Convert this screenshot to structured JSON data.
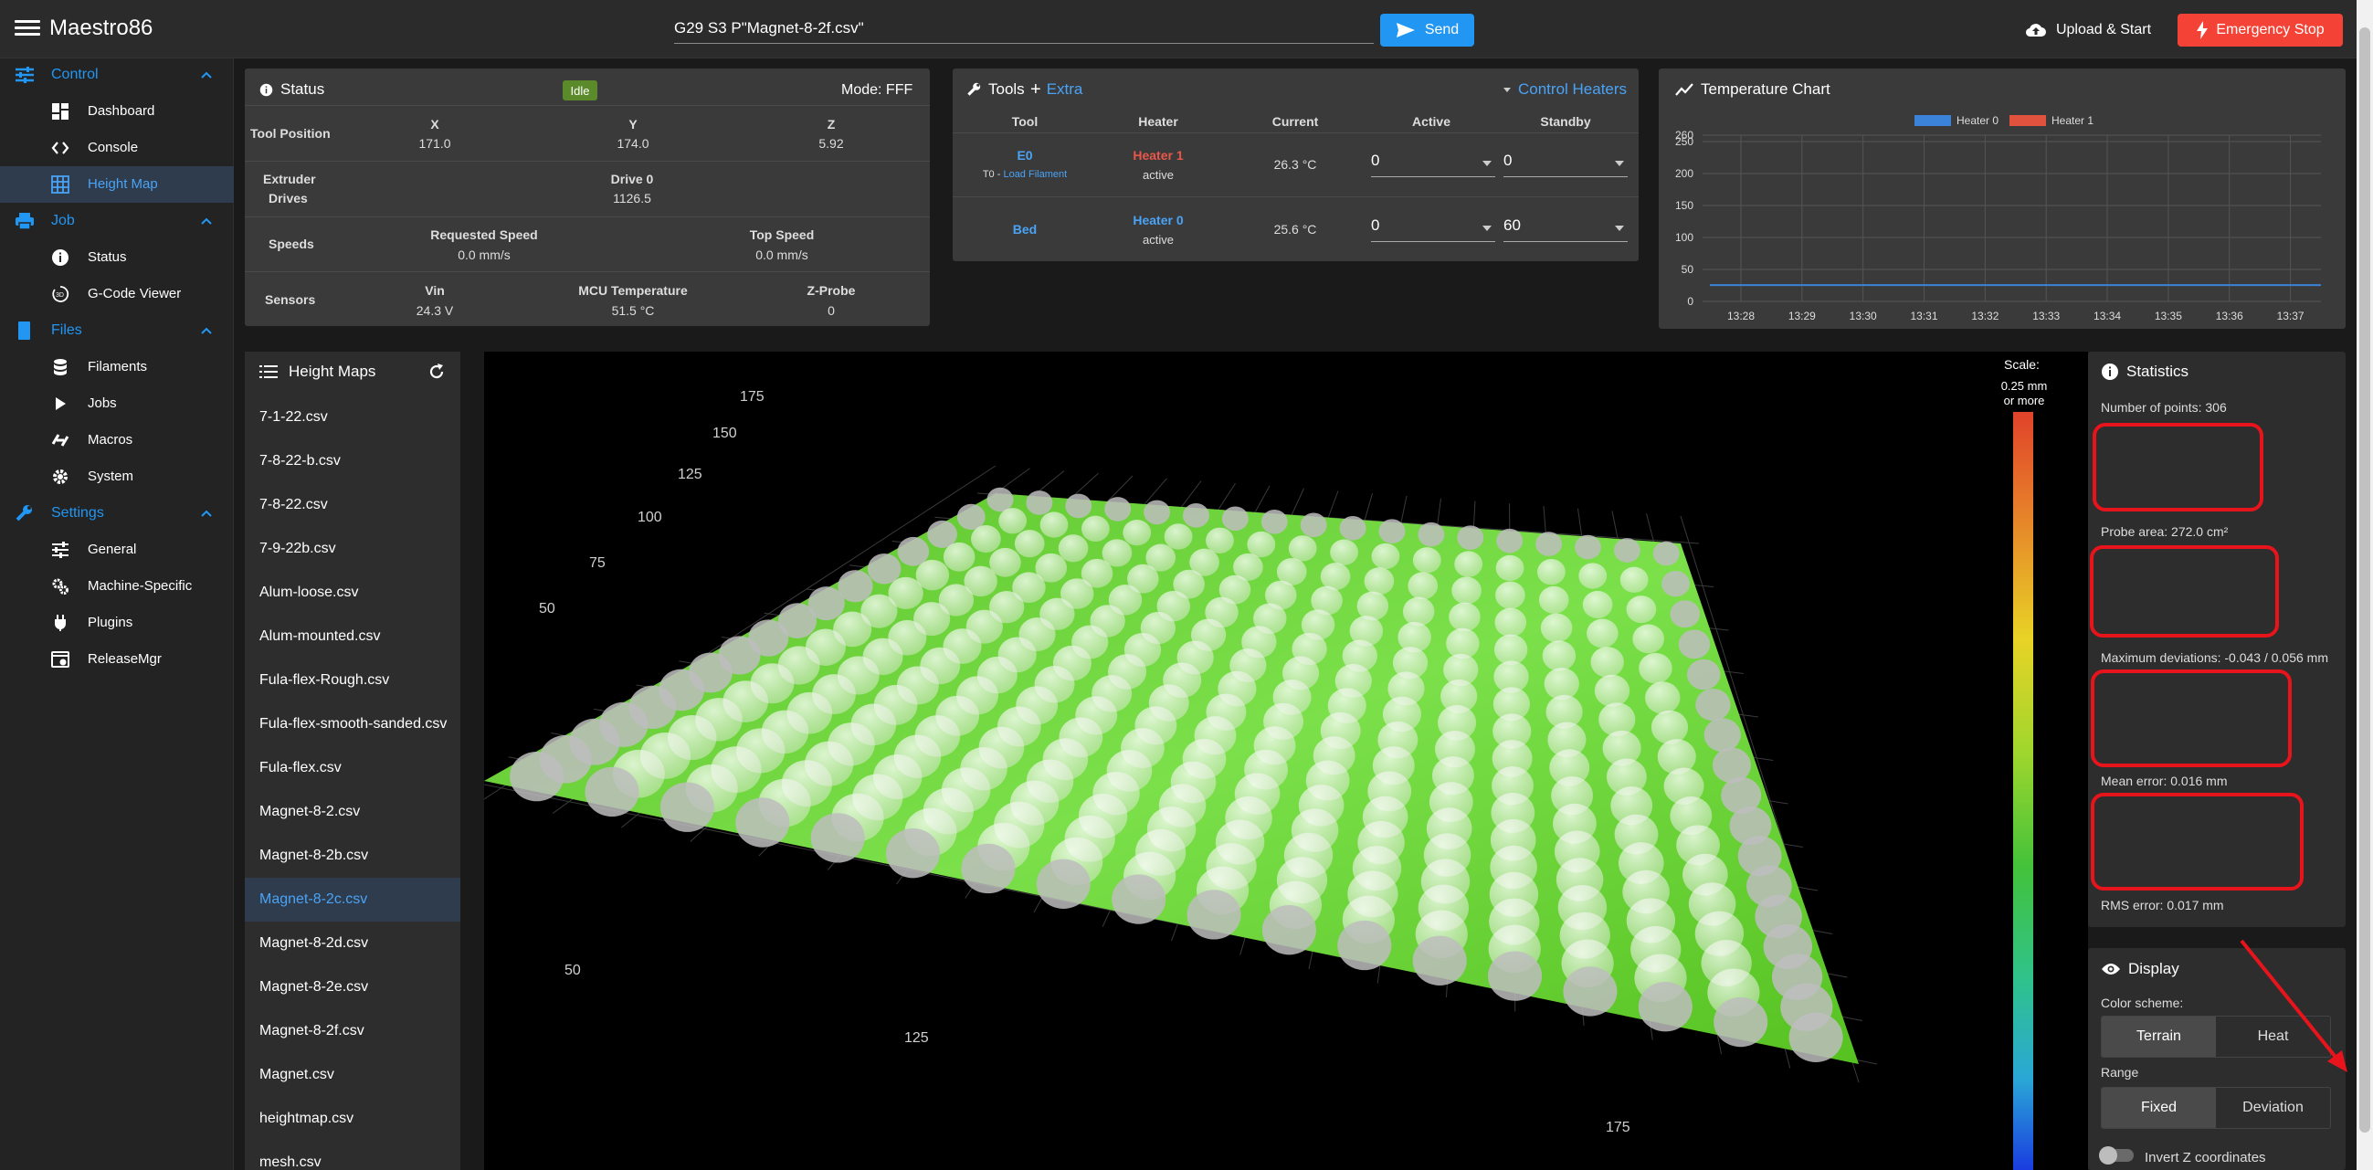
{
  "app": {
    "title": "Maestro86"
  },
  "topbar": {
    "code_value": "G29 S3 P\"Magnet-8-2f.csv\"",
    "send_label": "Send",
    "upload_label": "Upload & Start",
    "estop_label": "Emergency Stop"
  },
  "sidebar": {
    "groups": [
      {
        "label": "Control",
        "items": [
          "Dashboard",
          "Console",
          "Height Map"
        ]
      },
      {
        "label": "Job",
        "items": [
          "Status",
          "G-Code Viewer"
        ]
      },
      {
        "label": "Files",
        "items": [
          "Filaments",
          "Jobs",
          "Macros",
          "System"
        ]
      },
      {
        "label": "Settings",
        "items": [
          "General",
          "Machine-Specific",
          "Plugins",
          "ReleaseMgr"
        ]
      }
    ],
    "active_item": "Height Map"
  },
  "status": {
    "title": "Status",
    "state_badge": "Idle",
    "mode": "Mode: FFF",
    "tool_position_label": "Tool Position",
    "axes": [
      {
        "label": "X",
        "value": "171.0"
      },
      {
        "label": "Y",
        "value": "174.0"
      },
      {
        "label": "Z",
        "value": "5.92"
      }
    ],
    "extruder_label_1": "Extruder",
    "extruder_label_2": "Drives",
    "drive_label": "Drive 0",
    "drive_value": "1126.5",
    "speeds_label": "Speeds",
    "requested_speed_label": "Requested Speed",
    "requested_speed_value": "0.0 mm/s",
    "top_speed_label": "Top Speed",
    "top_speed_value": "0.0 mm/s",
    "sensors_label": "Sensors",
    "vin_label": "Vin",
    "vin_value": "24.3 V",
    "mcu_label": "MCU Temperature",
    "mcu_value": "51.5 °C",
    "zprobe_label": "Z-Probe",
    "zprobe_value": "0"
  },
  "tools": {
    "title": "Tools",
    "extra_label": "Extra",
    "control_heaters_label": "Control Heaters",
    "headers": [
      "Tool",
      "Heater",
      "Current",
      "Active",
      "Standby"
    ],
    "rows": [
      {
        "tool": "E0",
        "tool_sub_prefix": "T0 - ",
        "tool_sub_link": "Load Filament",
        "heater": "Heater 1",
        "heater_state": "active",
        "current": "26.3 °C",
        "active": "0",
        "standby": "0"
      },
      {
        "tool": "Bed",
        "heater": "Heater 0",
        "heater_state": "active",
        "current": "25.6 °C",
        "active": "0",
        "standby": "60"
      }
    ]
  },
  "temp_chart": {
    "title": "Temperature Chart",
    "chart_data": {
      "type": "line",
      "x": [
        "13:28",
        "13:29",
        "13:30",
        "13:31",
        "13:32",
        "13:33",
        "13:34",
        "13:35",
        "13:36",
        "13:37"
      ],
      "series": [
        {
          "name": "Heater 0",
          "color": "#3b82d9",
          "values": [
            25.6,
            25.6,
            25.6,
            25.6,
            25.6,
            25.6,
            25.6,
            25.6,
            25.6,
            25.6
          ]
        },
        {
          "name": "Heater 1",
          "color": "#e0523d",
          "values": []
        }
      ],
      "ylim": [
        0,
        260
      ],
      "yticks": [
        "0",
        "50",
        "100",
        "150",
        "200",
        "250",
        "260"
      ],
      "legend": "top-center",
      "grid": true
    }
  },
  "height_maps": {
    "title": "Height Maps",
    "files": [
      "7-1-22.csv",
      "7-8-22-b.csv",
      "7-8-22.csv",
      "7-9-22b.csv",
      "Alum-loose.csv",
      "Alum-mounted.csv",
      "Fula-flex-Rough.csv",
      "Fula-flex-smooth-sanded.csv",
      "Fula-flex.csv",
      "Magnet-8-2.csv",
      "Magnet-8-2b.csv",
      "Magnet-8-2c.csv",
      "Magnet-8-2d.csv",
      "Magnet-8-2e.csv",
      "Magnet-8-2f.csv",
      "Magnet.csv",
      "heightmap.csv",
      "mesh.csv"
    ],
    "selected": "Magnet-8-2c.csv"
  },
  "view3d": {
    "scale_label": "Scale:",
    "scale_top": "0.25 mm",
    "scale_top2": "or more",
    "axis_labels": [
      "175",
      "150",
      "125",
      "100",
      "75",
      "50",
      "50",
      "125",
      "175"
    ]
  },
  "statistics": {
    "title": "Statistics",
    "points": "Number of points: 306",
    "probe_area": "Probe area: 272.0 cm²",
    "max_dev": "Maximum deviations: -0.043 / 0.056 mm",
    "mean_error": "Mean error: 0.016 mm",
    "rms_error": "RMS error: 0.017 mm"
  },
  "display": {
    "title": "Display",
    "color_scheme_label": "Color scheme:",
    "scheme_options": [
      "Terrain",
      "Heat"
    ],
    "range_label": "Range",
    "range_options": [
      "Fixed",
      "Deviation"
    ],
    "invert_label": "Invert Z coordinates"
  }
}
